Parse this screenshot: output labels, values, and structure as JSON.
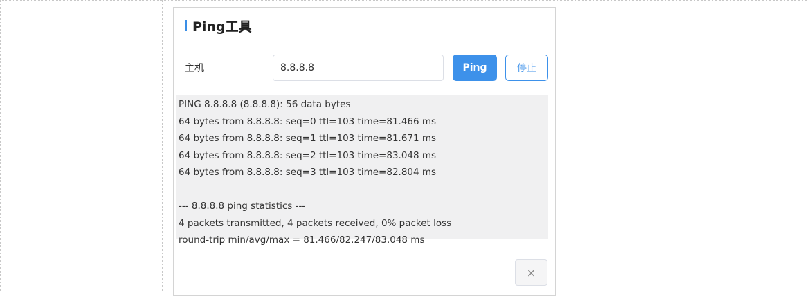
{
  "dialog": {
    "title": "Ping工具",
    "host_label": "主机",
    "host_value": "8.8.8.8",
    "ping_label": "Ping",
    "stop_label": "停止",
    "close_icon": "close-icon",
    "close_glyph": "×",
    "accent_color": "#3d91ea"
  },
  "output": {
    "lines": [
      "PING 8.8.8.8 (8.8.8.8): 56 data bytes",
      "64 bytes from 8.8.8.8: seq=0 ttl=103 time=81.466 ms",
      "64 bytes from 8.8.8.8: seq=1 ttl=103 time=81.671 ms",
      "64 bytes from 8.8.8.8: seq=2 ttl=103 time=83.048 ms",
      "64 bytes from 8.8.8.8: seq=3 ttl=103 time=82.804 ms",
      "",
      "--- 8.8.8.8 ping statistics ---",
      "4 packets transmitted, 4 packets received, 0% packet loss",
      "round-trip min/avg/max = 81.466/82.247/83.048 ms"
    ]
  }
}
